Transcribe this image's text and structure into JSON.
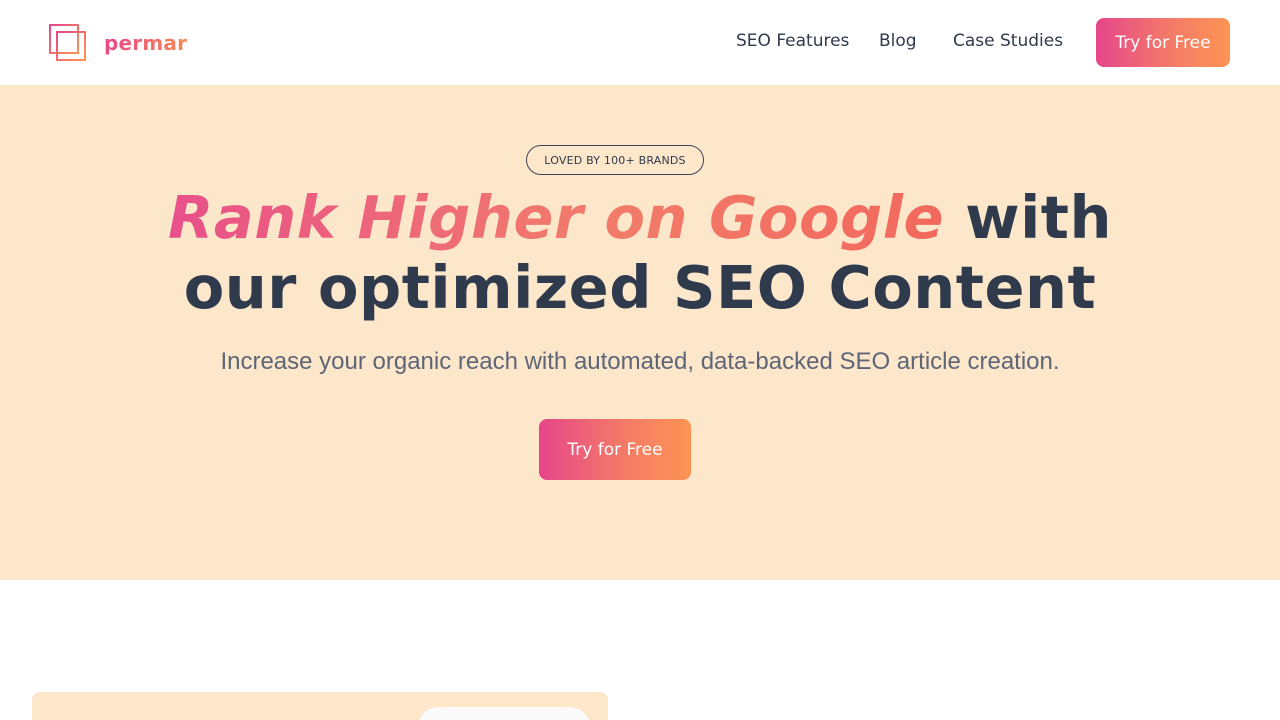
{
  "brand": {
    "name": "permar",
    "logo_icon": "overlapping-squares-icon",
    "colors": {
      "gradient_start": "#e6468a",
      "gradient_end": "#fd9453",
      "hero_background": "#fde7cb",
      "text_dark": "#2f3a4c",
      "text_muted": "#5d6577"
    }
  },
  "nav": {
    "links": [
      {
        "label": "SEO Features"
      },
      {
        "label": "Blog"
      },
      {
        "label": "Case Studies"
      }
    ],
    "cta_label": "Try for Free"
  },
  "hero": {
    "badge": "LOVED BY 100+ BRANDS",
    "headline_accent": "Rank Higher on Google",
    "headline_rest_line1": " with",
    "headline_line2": "our optimized SEO Content",
    "subheadline": "Increase your organic reach with automated, data-backed SEO article creation.",
    "cta_label": "Try for Free"
  }
}
